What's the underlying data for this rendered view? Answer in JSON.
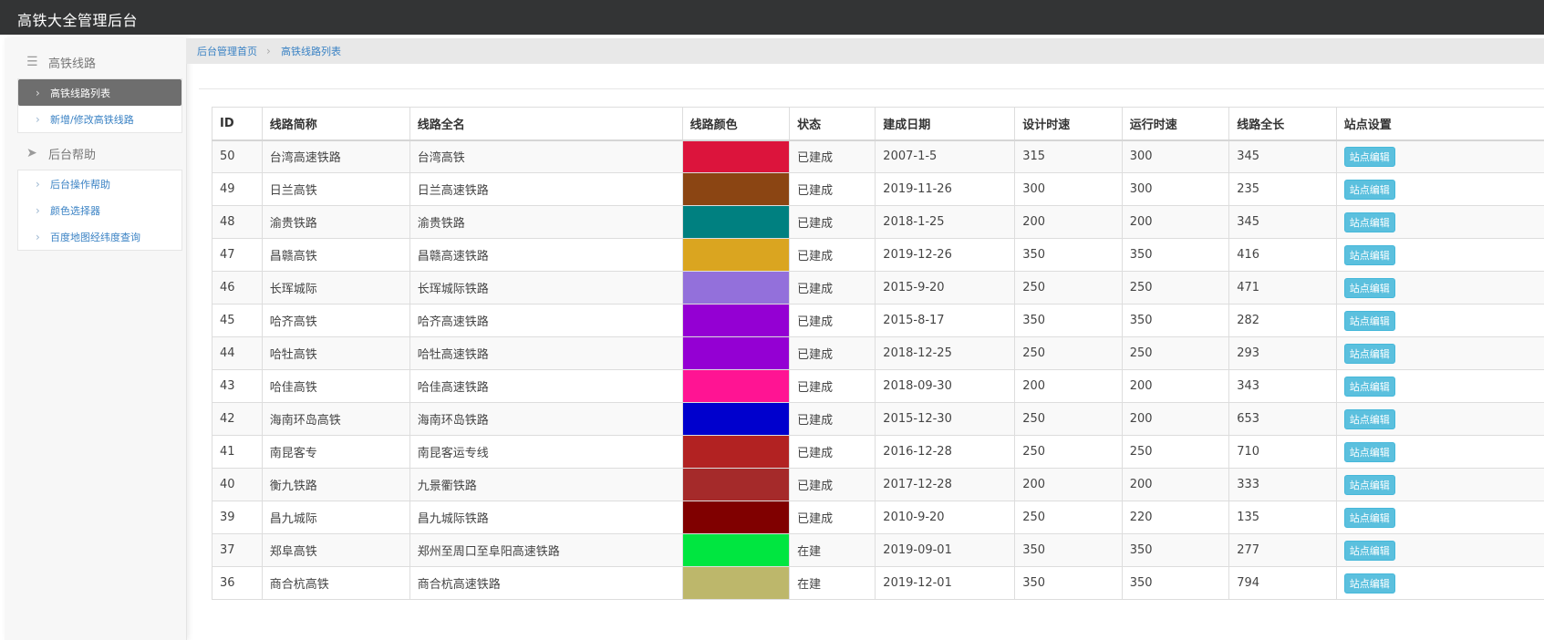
{
  "app": {
    "title": "高铁大全管理后台"
  },
  "sidebar": {
    "groups": [
      {
        "title": "高铁线路",
        "icon": "menu-icon",
        "items": [
          {
            "label": "高铁线路列表",
            "active": true
          },
          {
            "label": "新增/修改高铁线路",
            "active": false
          }
        ]
      },
      {
        "title": "后台帮助",
        "icon": "send-icon",
        "items": [
          {
            "label": "后台操作帮助",
            "active": false
          },
          {
            "label": "颜色选择器",
            "active": false
          },
          {
            "label": "百度地图经纬度查询",
            "active": false
          }
        ]
      }
    ]
  },
  "breadcrumb": {
    "home": "后台管理首页",
    "current": "高铁线路列表"
  },
  "table": {
    "headers": [
      "ID",
      "线路简称",
      "线路全名",
      "线路颜色",
      "状态",
      "建成日期",
      "设计时速",
      "运行时速",
      "线路全长",
      "站点设置"
    ],
    "edit_label": "站点编辑",
    "rows": [
      {
        "id": "50",
        "short": "台湾高速铁路",
        "full": "台湾高铁",
        "color": "#dc143c",
        "status": "已建成",
        "date": "2007-1-5",
        "design": "315",
        "run": "300",
        "length": "345"
      },
      {
        "id": "49",
        "short": "日兰高铁",
        "full": "日兰高速铁路",
        "color": "#8b4513",
        "status": "已建成",
        "date": "2019-11-26",
        "design": "300",
        "run": "300",
        "length": "235"
      },
      {
        "id": "48",
        "short": "渝贵铁路",
        "full": "渝贵铁路",
        "color": "#008080",
        "status": "已建成",
        "date": "2018-1-25",
        "design": "200",
        "run": "200",
        "length": "345"
      },
      {
        "id": "47",
        "short": "昌赣高铁",
        "full": "昌赣高速铁路",
        "color": "#daa520",
        "status": "已建成",
        "date": "2019-12-26",
        "design": "350",
        "run": "350",
        "length": "416"
      },
      {
        "id": "46",
        "short": "长珲城际",
        "full": "长珲城际铁路",
        "color": "#9370db",
        "status": "已建成",
        "date": "2015-9-20",
        "design": "250",
        "run": "250",
        "length": "471"
      },
      {
        "id": "45",
        "short": "哈齐高铁",
        "full": "哈齐高速铁路",
        "color": "#9400d3",
        "status": "已建成",
        "date": "2015-8-17",
        "design": "350",
        "run": "350",
        "length": "282"
      },
      {
        "id": "44",
        "short": "哈牡高铁",
        "full": "哈牡高速铁路",
        "color": "#9400d3",
        "status": "已建成",
        "date": "2018-12-25",
        "design": "250",
        "run": "250",
        "length": "293"
      },
      {
        "id": "43",
        "short": "哈佳高铁",
        "full": "哈佳高速铁路",
        "color": "#ff1493",
        "status": "已建成",
        "date": "2018-09-30",
        "design": "200",
        "run": "200",
        "length": "343"
      },
      {
        "id": "42",
        "short": "海南环岛高铁",
        "full": "海南环岛铁路",
        "color": "#0000cd",
        "status": "已建成",
        "date": "2015-12-30",
        "design": "250",
        "run": "200",
        "length": "653"
      },
      {
        "id": "41",
        "short": "南昆客专",
        "full": "南昆客运专线",
        "color": "#b22222",
        "status": "已建成",
        "date": "2016-12-28",
        "design": "250",
        "run": "250",
        "length": "710"
      },
      {
        "id": "40",
        "short": "衡九铁路",
        "full": "九景衢铁路",
        "color": "#a52a2a",
        "status": "已建成",
        "date": "2017-12-28",
        "design": "200",
        "run": "200",
        "length": "333"
      },
      {
        "id": "39",
        "short": "昌九城际",
        "full": "昌九城际铁路",
        "color": "#800000",
        "status": "已建成",
        "date": "2010-9-20",
        "design": "250",
        "run": "220",
        "length": "135"
      },
      {
        "id": "37",
        "short": "郑阜高铁",
        "full": "郑州至周口至阜阳高速铁路",
        "color": "#00e640",
        "status": "在建",
        "date": "2019-09-01",
        "design": "350",
        "run": "350",
        "length": "277"
      },
      {
        "id": "36",
        "short": "商合杭高铁",
        "full": "商合杭高速铁路",
        "color": "#bdb76b",
        "status": "在建",
        "date": "2019-12-01",
        "design": "350",
        "run": "350",
        "length": "794"
      }
    ]
  }
}
